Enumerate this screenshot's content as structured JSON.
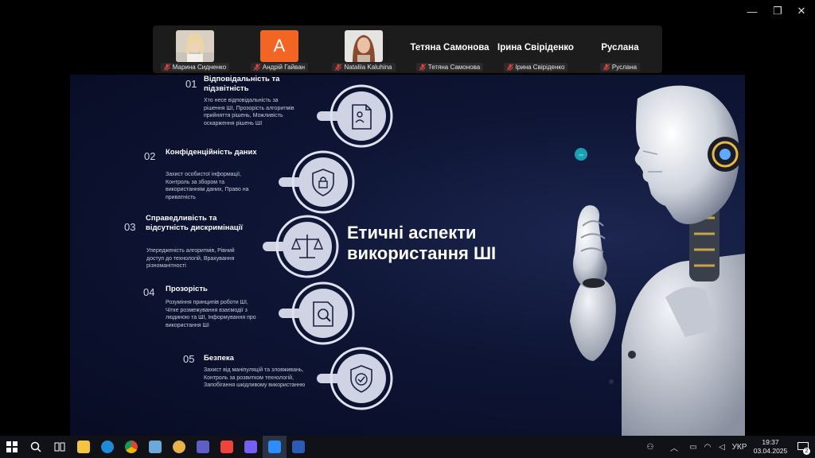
{
  "window": {
    "minimize_label": "—",
    "restore_label": "❐",
    "close_label": "✕"
  },
  "participants": [
    {
      "label": "Марина Сидненко",
      "avatar": "photo"
    },
    {
      "label": "Андрій Гайван",
      "avatar_letter": "А"
    },
    {
      "label": "Nataliia Kaluhina",
      "avatar": "photo"
    },
    {
      "big_name": "Тетяна Самонова",
      "label": "Тетяна Самонова"
    },
    {
      "big_name": "Ірина Свіріденко",
      "label": "Ірина Свіріденко"
    },
    {
      "big_name": "Руслана",
      "label": "Руслана"
    }
  ],
  "slide": {
    "title_line1": "Етичні аспекти",
    "title_line2": "використання ШІ",
    "items": [
      {
        "num": "01",
        "title_line1": "Відповідальність та",
        "title_line2": "підзвітність",
        "desc": [
          "Хто несе відповідальність за",
          "рішення ШІ, Прозорість алгоритмів",
          "прийняття рішень, Можливість",
          "оскарження рішень ШІ"
        ],
        "icon": "document-person-icon"
      },
      {
        "num": "02",
        "title_line1": "Конфіденційність даних",
        "title_line2": "",
        "desc": [
          "Захист особистої інформації,",
          "Контроль за збором та",
          "використанням даних,  Право на",
          "приватність"
        ],
        "icon": "shield-lock-icon"
      },
      {
        "num": "03",
        "title_line1": "Справедливість та",
        "title_line2": "відсутність дискримінації",
        "desc": [
          "Упередженість алгоритмів, Рівний",
          "доступ до технологій,  Врахування",
          "різноманітності"
        ],
        "icon": "scales-icon"
      },
      {
        "num": "04",
        "title_line1": "Прозорість",
        "title_line2": "",
        "desc": [
          "Розуміння принципів роботи ШІ,",
          "Чітке розмежування взаємодії з",
          "людиною та ШІ, Інформування про",
          "використання ШІ"
        ],
        "icon": "document-search-icon"
      },
      {
        "num": "05",
        "title_line1": "Безпека",
        "title_line2": "",
        "desc": [
          "Захист від маніпуляцій та зловживань,",
          "Контроль за розвитком технологій,",
          "Запобігання шкідливому використанню"
        ],
        "icon": "shield-check-icon"
      }
    ]
  },
  "taskbar": {
    "apps": [
      "start-icon",
      "search-icon",
      "task-view-icon",
      "file-explorer-icon",
      "edge-icon",
      "chrome-icon",
      "photos-icon",
      "paint-icon",
      "teams-icon",
      "anydesk-icon",
      "viber-icon",
      "zoom-icon",
      "word-icon"
    ],
    "lang": "УКР",
    "time": "19:37",
    "date": "03.04.2025",
    "notifications": "2"
  },
  "colors": {
    "accent_orange": "#f26522",
    "slide_bg": "#0e1535",
    "zoom_blue": "#2d8cff"
  }
}
